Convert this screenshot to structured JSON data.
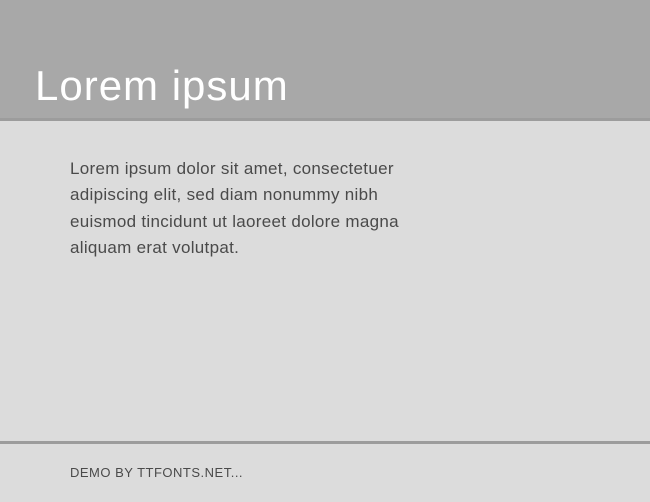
{
  "header": {
    "title": "Lorem ipsum"
  },
  "content": {
    "body": "Lorem ipsum dolor sit amet, consectetuer adipiscing elit, sed diam nonummy nibh euismod tincidunt ut laoreet dolore magna aliquam erat volutpat."
  },
  "footer": {
    "credit": "DEMO BY TTFONTS.NET..."
  }
}
